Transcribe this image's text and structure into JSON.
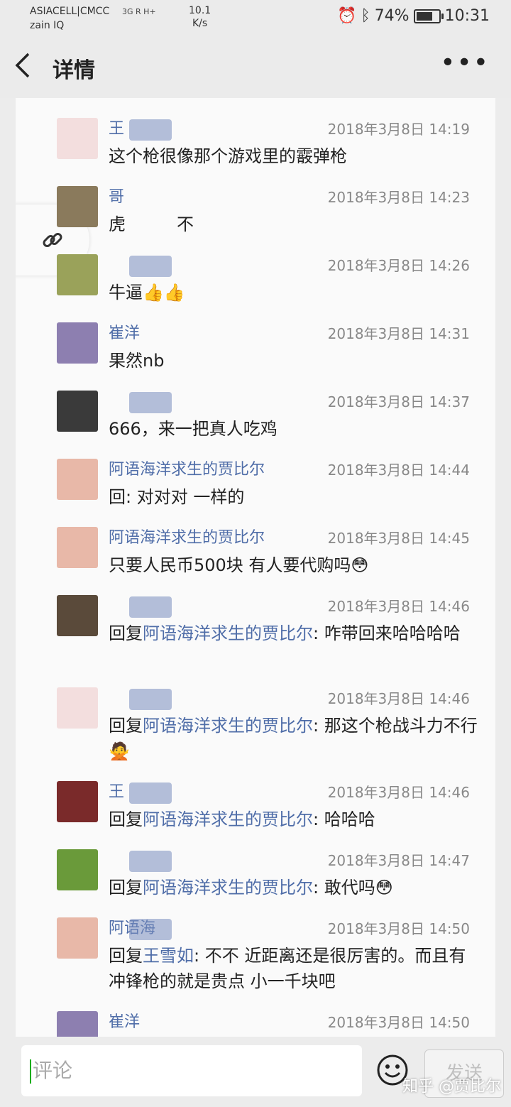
{
  "status_bar": {
    "carrier_line1": "ASIACELL|CMCC",
    "carrier_line2": "zain IQ",
    "network": "3G R  H+",
    "speed_line1": "10.1",
    "speed_line2": "K/s",
    "battery": "74%",
    "battery_level": 0.74,
    "time": "10:31"
  },
  "header": {
    "back_icon": "chevron-left-icon",
    "title": "详情",
    "more": "•••"
  },
  "comments": [
    {
      "name": "王",
      "time": "2018年3月8日 14:19",
      "text": "这个枪很像那个游戏里的霰弹枪",
      "avatar_color": "#f3dede"
    },
    {
      "name": "哥",
      "time": "2018年3月8日 14:23",
      "text": "虎　　　不",
      "avatar_color": "#8a7a5c"
    },
    {
      "name": "",
      "time": "2018年3月8日 14:26",
      "text": "牛逼👍👍",
      "avatar_color": "#9aa25a"
    },
    {
      "name": "崔洋",
      "time": "2018年3月8日 14:31",
      "text": "果然nb",
      "avatar_color": "#8d7fb0"
    },
    {
      "name": "",
      "time": "2018年3月8日 14:37",
      "text": "666，来一把真人吃鸡",
      "avatar_color": "#3a3a3a"
    },
    {
      "name": "阿语海洋求生的贾比尔",
      "time": "2018年3月8日 14:44",
      "text_prefix": "回",
      "text_ref": "",
      "text": ": 对对对 一样的",
      "avatar_color": "#e8b8a8"
    },
    {
      "name": "阿语海洋求生的贾比尔",
      "time": "2018年3月8日 14:45",
      "text": "只要人民币500块  有人要代购吗😳",
      "avatar_color": "#e8b8a8"
    },
    {
      "name": "",
      "time": "2018年3月8日 14:46",
      "text_prefix": "回复",
      "text_ref": "阿语海洋求生的贾比尔",
      "text": ": 咋带回来哈哈哈哈",
      "avatar_color": "#5a4a3a"
    },
    {
      "name": "",
      "time": "2018年3月8日 14:46",
      "text_prefix": "回复",
      "text_ref": "阿语海洋求生的贾比尔",
      "text": ": 那这个枪战斗力不行🙅",
      "avatar_color": "#f3dede"
    },
    {
      "name": "王",
      "time": "2018年3月8日 14:46",
      "text_prefix": "回复",
      "text_ref": "阿语海洋求生的贾比尔",
      "text": ": 哈哈哈",
      "avatar_color": "#7a2a2a"
    },
    {
      "name": "",
      "time": "2018年3月8日 14:47",
      "text_prefix": "回复",
      "text_ref": "阿语海洋求生的贾比尔",
      "text": ": 敢代吗😳",
      "avatar_color": "#6a9a3a"
    },
    {
      "name": "阿语海",
      "time": "2018年3月8日 14:50",
      "text_prefix": "回复",
      "text_ref": "王雪如",
      "text": ": 不不 近距离还是很厉害的。而且有冲锋枪的就是贵点 小一千块吧",
      "avatar_color": "#e8b8a8"
    },
    {
      "name": "崔洋",
      "time": "2018年3月8日 14:50",
      "text": "",
      "avatar_color": "#8d7fb0"
    }
  ],
  "bottom": {
    "comment_placeholder": "评论",
    "emoji_icon": "smiley-icon",
    "send_label": "发送",
    "watermark": "知乎 @贾比尔"
  }
}
